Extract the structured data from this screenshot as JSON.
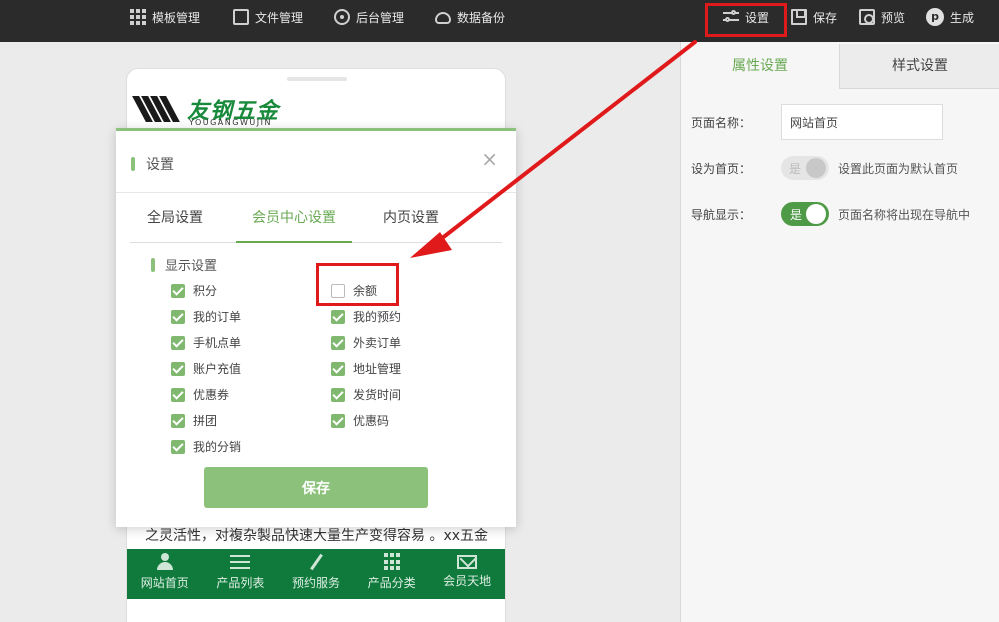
{
  "toolbar": {
    "left_items": [
      {
        "label": "模板管理",
        "icon": "grid-icon"
      },
      {
        "label": "文件管理",
        "icon": "file-icon"
      },
      {
        "label": "后台管理",
        "icon": "gear-icon"
      },
      {
        "label": "数据备份",
        "icon": "cloud-upload-icon"
      }
    ],
    "right_items": [
      {
        "label": "设置",
        "icon": "sliders-icon"
      },
      {
        "label": "保存",
        "icon": "save-icon"
      },
      {
        "label": "预览",
        "icon": "preview-icon"
      },
      {
        "label": "生成",
        "icon": "generate-icon"
      }
    ]
  },
  "phone": {
    "logo_cn": "友钢五金",
    "logo_en": "YOUGANGWUJIN",
    "marquee_text": "之灵活性，对複杂製品快速大量生产变得容易 。xx五金",
    "bottom_nav": [
      {
        "label": "网站首页",
        "icon": "person-icon"
      },
      {
        "label": "产品列表",
        "icon": "list-icon"
      },
      {
        "label": "预约服务",
        "icon": "wrench-icon"
      },
      {
        "label": "产品分类",
        "icon": "grid-icon"
      },
      {
        "label": "会员天地",
        "icon": "mail-icon"
      }
    ]
  },
  "dialog": {
    "title": "设置",
    "close": "×",
    "tabs": [
      "全局设置",
      "会员中心设置",
      "内页设置"
    ],
    "active_tab": "会员中心设置",
    "section_title": "显示设置",
    "options": [
      {
        "label": "积分",
        "checked": true
      },
      {
        "label": "余额",
        "checked": false
      },
      {
        "label": "我的订单",
        "checked": true
      },
      {
        "label": "我的预约",
        "checked": true
      },
      {
        "label": "手机点单",
        "checked": true
      },
      {
        "label": "外卖订单",
        "checked": true
      },
      {
        "label": "账户充值",
        "checked": true
      },
      {
        "label": "地址管理",
        "checked": true
      },
      {
        "label": "优惠券",
        "checked": true
      },
      {
        "label": "发货时间",
        "checked": true
      },
      {
        "label": "拼团",
        "checked": true
      },
      {
        "label": "优惠码",
        "checked": true
      },
      {
        "label": "我的分销",
        "checked": true
      }
    ],
    "save_label": "保存"
  },
  "panel": {
    "tabs": [
      "属性设置",
      "样式设置"
    ],
    "page_name_label": "页面名称：",
    "page_name_value": "网站首页",
    "homepage_label": "设为首页：",
    "homepage_toggle": "是",
    "homepage_on": false,
    "homepage_desc": "设置此页面为默认首页",
    "nav_label": "导航显示：",
    "nav_toggle": "是",
    "nav_on": true,
    "nav_desc": "页面名称将出现在导航中"
  },
  "colors": {
    "accent_green": "#8cc17c",
    "tab_green": "#6aa954",
    "nav_green": "#0f7a3b",
    "annotation_red": "#e0191b",
    "topbar": "#2b2b2b"
  }
}
